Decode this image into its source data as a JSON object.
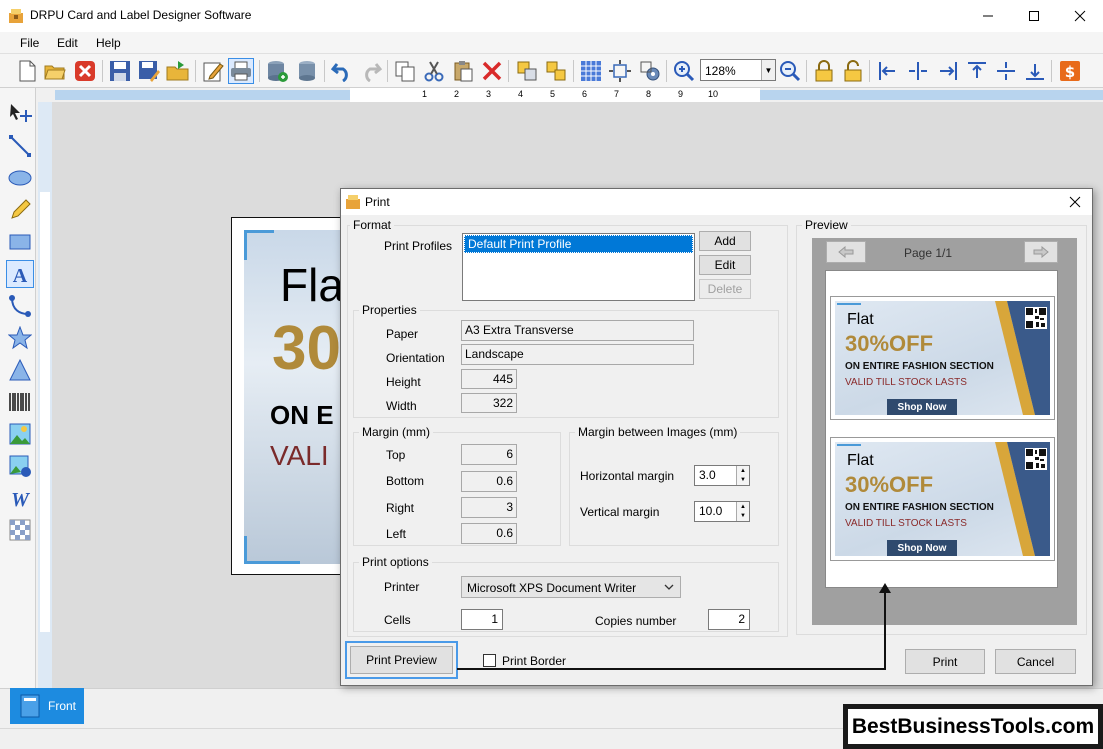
{
  "window": {
    "title": "DRPU Card and Label Designer Software"
  },
  "menu": {
    "file": "File",
    "edit": "Edit",
    "help": "Help"
  },
  "toolbar": {
    "zoom": "128%"
  },
  "ruler": {
    "ticks": [
      "1",
      "2",
      "3",
      "4",
      "5",
      "6",
      "7",
      "8",
      "9",
      "10"
    ]
  },
  "card": {
    "line1": "Fla",
    "line2": "30",
    "line3": "ON E",
    "line4": "VALI"
  },
  "tabs": {
    "front": "Front"
  },
  "brand": "BestBusinessTools.com",
  "dialog": {
    "title": "Print",
    "format": {
      "label": "Format",
      "profiles_label": "Print Profiles",
      "profile_selected": "Default Print Profile",
      "add": "Add",
      "edit": "Edit",
      "delete": "Delete"
    },
    "properties": {
      "label": "Properties",
      "paper_label": "Paper",
      "paper": "A3 Extra Transverse",
      "orientation_label": "Orientation",
      "orientation": "Landscape",
      "height_label": "Height",
      "height": "445",
      "width_label": "Width",
      "width": "322"
    },
    "margin": {
      "label": "Margin (mm)",
      "top_label": "Top",
      "top": "6",
      "bottom_label": "Bottom",
      "bottom": "0.6",
      "right_label": "Right",
      "right": "3",
      "left_label": "Left",
      "left": "0.6"
    },
    "margin_images": {
      "label": "Margin between Images (mm)",
      "horizontal_label": "Horizontal margin",
      "horizontal": "3.0",
      "vertical_label": "Vertical margin",
      "vertical": "10.0"
    },
    "print_options": {
      "label": "Print options",
      "printer_label": "Printer",
      "printer": "Microsoft XPS Document Writer",
      "cells_label": "Cells",
      "cells": "1",
      "copies_label": "Copies number",
      "copies": "2"
    },
    "preview": {
      "label": "Preview",
      "page": "Page 1/1",
      "card": {
        "flat": "Flat",
        "off": "30%OFF",
        "line1": "ON ENTIRE FASHION SECTION",
        "line2": "VALID TILL STOCK LASTS",
        "shop": "Shop Now"
      }
    },
    "print_preview": "Print Preview",
    "print_border": "Print Border",
    "print": "Print",
    "cancel": "Cancel"
  }
}
